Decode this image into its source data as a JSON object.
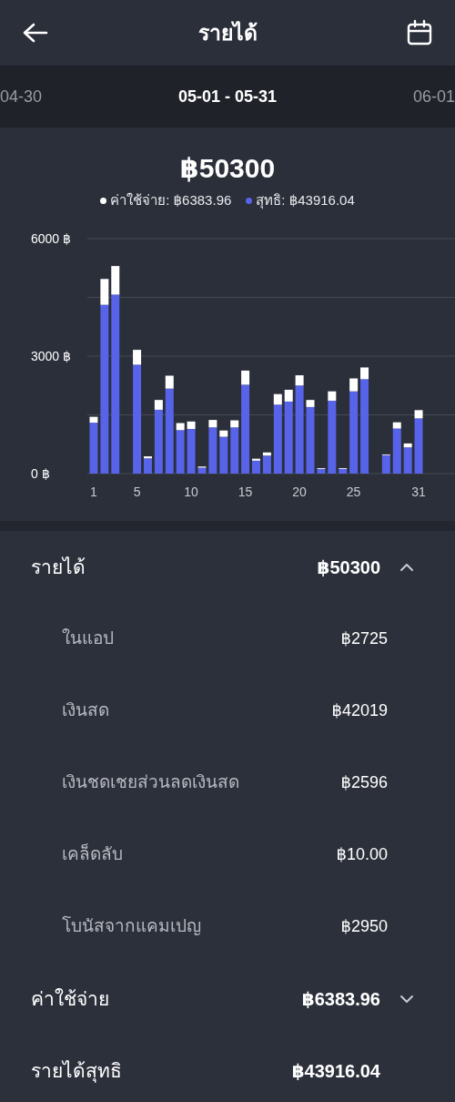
{
  "header": {
    "title": "รายได้"
  },
  "periods": [
    {
      "label": "04-30",
      "selected": false
    },
    {
      "label": "05-01 - 05-31",
      "selected": true
    },
    {
      "label": "06-01",
      "selected": false
    }
  ],
  "summary": {
    "total": "฿50300",
    "legend": [
      {
        "label": "ค่าใช้จ่าย: ฿6383.96",
        "color": "#ffffff"
      },
      {
        "label": "สุทธิ: ฿43916.04",
        "color": "#5763e8"
      }
    ]
  },
  "chart_data": {
    "type": "bar",
    "stacked": true,
    "x": [
      1,
      2,
      3,
      4,
      5,
      6,
      7,
      8,
      9,
      10,
      11,
      12,
      13,
      14,
      15,
      16,
      17,
      18,
      19,
      20,
      21,
      22,
      23,
      24,
      25,
      26,
      27,
      28,
      29,
      30,
      31
    ],
    "xlim": [
      0.5,
      31.5
    ],
    "series": [
      {
        "color": "#5763e8",
        "values": [
          1300,
          4310,
          4570,
          0,
          2780,
          390,
          1630,
          2170,
          1110,
          1140,
          150,
          1180,
          940,
          1180,
          2270,
          330,
          460,
          1760,
          1840,
          2250,
          1700,
          120,
          1860,
          120,
          2100,
          2410,
          0,
          470,
          1150,
          670,
          1410
        ]
      },
      {
        "color": "#ffffff",
        "values": [
          150,
          660,
          730,
          0,
          380,
          50,
          250,
          330,
          180,
          190,
          30,
          190,
          160,
          180,
          360,
          50,
          80,
          270,
          300,
          260,
          180,
          20,
          240,
          20,
          330,
          300,
          0,
          20,
          160,
          100,
          210
        ]
      }
    ],
    "xticks": [
      {
        "value": 1,
        "label": "1"
      },
      {
        "value": 5,
        "label": "5"
      },
      {
        "value": 10,
        "label": "10"
      },
      {
        "value": 15,
        "label": "15"
      },
      {
        "value": 20,
        "label": "20"
      },
      {
        "value": 25,
        "label": "25"
      },
      {
        "value": 31,
        "label": "31"
      }
    ],
    "yticks": [
      {
        "value": 0,
        "label": "0 ฿"
      },
      {
        "value": 3000,
        "label": "3000 ฿"
      },
      {
        "value": 6000,
        "label": "6000 ฿"
      }
    ],
    "ylim": [
      0,
      6000
    ]
  },
  "sections": [
    {
      "kind": "group",
      "label": "รายได้",
      "amount": "฿50300",
      "expanded": true,
      "children": [
        {
          "label": "ในแอป",
          "amount": "฿2725"
        },
        {
          "label": "เงินสด",
          "amount": "฿42019"
        },
        {
          "label": "เงินชดเชยส่วนลดเงินสด",
          "amount": "฿2596"
        },
        {
          "label": "เคล็ดลับ",
          "amount": "฿10.00"
        },
        {
          "label": "โบนัสจากแคมเปญ",
          "amount": "฿2950"
        }
      ]
    },
    {
      "kind": "group",
      "label": "ค่าใช้จ่าย",
      "amount": "฿6383.96",
      "expanded": false
    },
    {
      "kind": "total",
      "label": "รายได้สุทธิ",
      "amount": "฿43916.04"
    }
  ]
}
